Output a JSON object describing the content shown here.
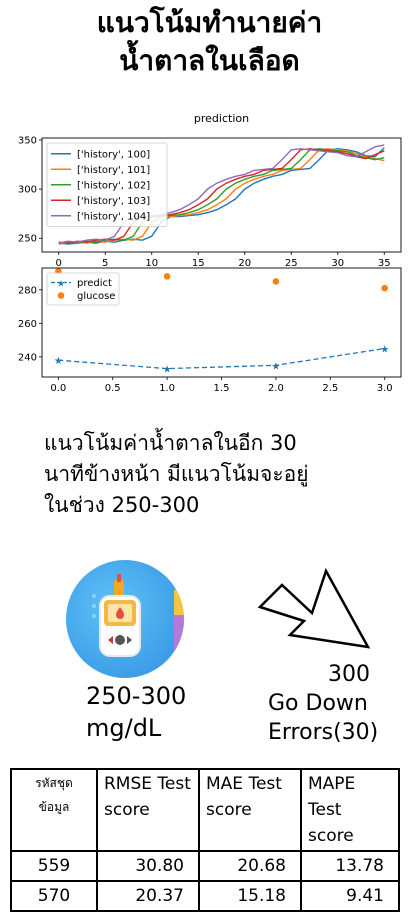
{
  "title": {
    "line1": "แนวโน้มทำนายค่า",
    "line2": "น้ำตาลในเลือด"
  },
  "chart_data": [
    {
      "type": "line",
      "title": "prediction",
      "xlim": [
        -1.8,
        36.8
      ],
      "ylim": [
        236,
        352
      ],
      "xticks": [
        0,
        5,
        10,
        15,
        20,
        25,
        30,
        35
      ],
      "yticks": [
        250,
        300,
        350
      ],
      "legend": "top-left",
      "series": [
        {
          "name": "['history', 100]",
          "color": "#1f77b4",
          "x": [
            0,
            1,
            2,
            3,
            4,
            5,
            6,
            7,
            8,
            9,
            10,
            11,
            12,
            13,
            14,
            15,
            16,
            17,
            18,
            19,
            20,
            21,
            22,
            23,
            24,
            25,
            26,
            27,
            28,
            29,
            30,
            31,
            32,
            33,
            34,
            35
          ],
          "y": [
            245,
            244,
            245,
            246,
            245,
            247,
            246,
            248,
            249,
            248,
            252,
            266,
            272,
            272,
            273,
            274,
            276,
            279,
            284,
            290,
            300,
            306,
            310,
            313,
            315,
            319,
            320,
            321,
            330,
            340,
            341,
            340,
            338,
            334,
            333,
            342
          ]
        },
        {
          "name": "['history', 101]",
          "color": "#ff7f0e",
          "x": [
            0,
            1,
            2,
            3,
            4,
            5,
            6,
            7,
            8,
            9,
            10,
            11,
            12,
            13,
            14,
            15,
            16,
            17,
            18,
            19,
            20,
            21,
            22,
            23,
            24,
            25,
            26,
            27,
            28,
            29,
            30,
            31,
            32,
            33,
            34,
            35
          ],
          "y": [
            244,
            245,
            246,
            245,
            247,
            246,
            248,
            249,
            248,
            252,
            266,
            272,
            272,
            273,
            274,
            276,
            279,
            284,
            290,
            300,
            306,
            310,
            313,
            315,
            319,
            320,
            321,
            330,
            340,
            341,
            340,
            339,
            336,
            333,
            331,
            329
          ]
        },
        {
          "name": "['history', 102]",
          "color": "#2ca02c",
          "x": [
            0,
            1,
            2,
            3,
            4,
            5,
            6,
            7,
            8,
            9,
            10,
            11,
            12,
            13,
            14,
            15,
            16,
            17,
            18,
            19,
            20,
            21,
            22,
            23,
            24,
            25,
            26,
            27,
            28,
            29,
            30,
            31,
            32,
            33,
            34,
            35
          ],
          "y": [
            245,
            246,
            245,
            247,
            246,
            248,
            249,
            248,
            252,
            266,
            272,
            272,
            273,
            274,
            276,
            279,
            284,
            290,
            300,
            306,
            310,
            313,
            315,
            319,
            320,
            321,
            330,
            340,
            341,
            340,
            339,
            338,
            334,
            332,
            330,
            332
          ]
        },
        {
          "name": "['history', 103]",
          "color": "#d62728",
          "x": [
            0,
            1,
            2,
            3,
            4,
            5,
            6,
            7,
            8,
            9,
            10,
            11,
            12,
            13,
            14,
            15,
            16,
            17,
            18,
            19,
            20,
            21,
            22,
            23,
            24,
            25,
            26,
            27,
            28,
            29,
            30,
            31,
            32,
            33,
            34,
            35
          ],
          "y": [
            246,
            245,
            247,
            246,
            248,
            249,
            248,
            252,
            266,
            272,
            272,
            273,
            274,
            276,
            279,
            284,
            290,
            300,
            306,
            310,
            313,
            315,
            319,
            320,
            321,
            330,
            340,
            341,
            340,
            339,
            338,
            336,
            333,
            331,
            335,
            339
          ]
        },
        {
          "name": "['history', 104]",
          "color": "#9467bd",
          "x": [
            0,
            1,
            2,
            3,
            4,
            5,
            6,
            7,
            8,
            9,
            10,
            11,
            12,
            13,
            14,
            15,
            16,
            17,
            18,
            19,
            20,
            21,
            22,
            23,
            24,
            25,
            26,
            27,
            28,
            29,
            30,
            31,
            32,
            33,
            34,
            35
          ],
          "y": [
            245,
            247,
            246,
            248,
            249,
            248,
            252,
            266,
            272,
            272,
            273,
            274,
            276,
            279,
            284,
            290,
            300,
            306,
            310,
            313,
            315,
            319,
            320,
            321,
            330,
            340,
            341,
            340,
            339,
            338,
            337,
            334,
            333,
            338,
            343,
            345
          ]
        }
      ]
    },
    {
      "type": "line",
      "title": "",
      "xlim": [
        -0.15,
        3.15
      ],
      "ylim": [
        228,
        293
      ],
      "xticks": [
        0.0,
        0.5,
        1.0,
        1.5,
        2.0,
        2.5,
        3.0
      ],
      "yticks": [
        240,
        260,
        280
      ],
      "legend": "top-left",
      "series": [
        {
          "name": "predict",
          "color": "#1f77b4",
          "style": "dashed-star",
          "x": [
            0,
            1,
            2,
            3
          ],
          "y": [
            238,
            233,
            235,
            245
          ]
        },
        {
          "name": "glucose",
          "color": "#ff7f0e",
          "style": "dots",
          "x": [
            0,
            1,
            2,
            3
          ],
          "y": [
            291,
            288,
            285,
            281
          ]
        }
      ]
    }
  ],
  "description": {
    "line1": "แนวโน้มค่าน้ำตาลในอีก 30",
    "line2": "นาทีข้างหน้า มีแนวโน้มจะอยู่",
    "line3": "ในช่วง 250-300"
  },
  "range_value": "250-300",
  "range_unit": "mg/dL",
  "prediction": {
    "value": "300",
    "trend": "Go Down",
    "errors": "Errors(30)"
  },
  "icons": {
    "app": "glucose-meter-icon",
    "arrow": "arrow-down-right-icon"
  },
  "table": {
    "header": [
      "รหัสชุด ข้อมูล",
      "RMSE Test score",
      "MAE Test score",
      "MAPE Test score"
    ],
    "rows": [
      [
        "559",
        "30.80",
        "20.68",
        "13.78"
      ],
      [
        "570",
        "20.37",
        "15.18",
        "9.41"
      ]
    ]
  }
}
